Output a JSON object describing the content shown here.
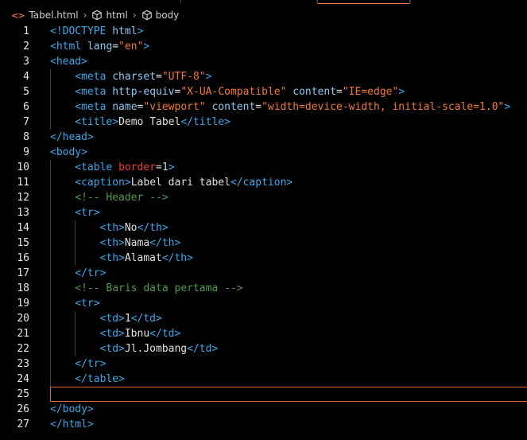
{
  "breadcrumb": {
    "file": "Tabel.html",
    "path": [
      "html",
      "body"
    ],
    "icons": [
      "code-brackets-icon",
      "cube-icon"
    ]
  },
  "editor": {
    "line_numbers": [
      "1",
      "2",
      "3",
      "4",
      "5",
      "6",
      "7",
      "8",
      "9",
      "10",
      "11",
      "12",
      "13",
      "14",
      "15",
      "16",
      "17",
      "18",
      "19",
      "20",
      "21",
      "22",
      "23",
      "24",
      "25",
      "26",
      "27"
    ],
    "current_line": "25",
    "lines": [
      [
        [
          "t",
          "<!DOCTYPE "
        ],
        [
          "a",
          "html"
        ],
        [
          "t",
          ">"
        ]
      ],
      [
        [
          "t",
          "<html "
        ],
        [
          "a",
          "lang"
        ],
        [
          "p",
          "="
        ],
        [
          "s",
          "\"en\""
        ],
        [
          "t",
          ">"
        ]
      ],
      [
        [
          "t",
          "<head>"
        ]
      ],
      [
        [
          "t",
          "<meta "
        ],
        [
          "a",
          "charset"
        ],
        [
          "p",
          "="
        ],
        [
          "s",
          "\"UTF-8\""
        ],
        [
          "t",
          ">"
        ]
      ],
      [
        [
          "t",
          "<meta "
        ],
        [
          "a",
          "http-equiv"
        ],
        [
          "p",
          "="
        ],
        [
          "s",
          "\"X-UA-Compatible\""
        ],
        [
          "p",
          " "
        ],
        [
          "a",
          "content"
        ],
        [
          "p",
          "="
        ],
        [
          "s",
          "\"IE=edge\""
        ],
        [
          "t",
          ">"
        ]
      ],
      [
        [
          "t",
          "<meta "
        ],
        [
          "a",
          "name"
        ],
        [
          "p",
          "="
        ],
        [
          "s",
          "\"viewport\""
        ],
        [
          "p",
          " "
        ],
        [
          "a",
          "content"
        ],
        [
          "p",
          "="
        ],
        [
          "s",
          "\"width=device-width, initial-scale=1.0\""
        ],
        [
          "t",
          ">"
        ]
      ],
      [
        [
          "t",
          "<title>"
        ],
        [
          "p",
          "Demo Tabel"
        ],
        [
          "t",
          "</title>"
        ]
      ],
      [
        [
          "t",
          "</head>"
        ]
      ],
      [
        [
          "t",
          "<body>"
        ]
      ],
      [
        [
          "t",
          "<table "
        ],
        [
          "r",
          "border"
        ],
        [
          "p",
          "="
        ],
        [
          "n",
          "1"
        ],
        [
          "t",
          ">"
        ]
      ],
      [
        [
          "t",
          "<caption>"
        ],
        [
          "p",
          "Label dari tabel"
        ],
        [
          "t",
          "</caption>"
        ]
      ],
      [
        [
          "c",
          "<!-- Header -->"
        ]
      ],
      [
        [
          "t",
          "<tr>"
        ]
      ],
      [
        [
          "t",
          "<th>"
        ],
        [
          "p",
          "No"
        ],
        [
          "t",
          "</th>"
        ]
      ],
      [
        [
          "t",
          "<th>"
        ],
        [
          "p",
          "Nama"
        ],
        [
          "t",
          "</th>"
        ]
      ],
      [
        [
          "t",
          "<th>"
        ],
        [
          "p",
          "Alamat"
        ],
        [
          "t",
          "</th>"
        ]
      ],
      [
        [
          "t",
          "</tr>"
        ]
      ],
      [
        [
          "c",
          "<!-- Baris data pertama -->"
        ]
      ],
      [
        [
          "t",
          "<tr>"
        ]
      ],
      [
        [
          "t",
          "<td>"
        ],
        [
          "p",
          "1"
        ],
        [
          "t",
          "</td>"
        ]
      ],
      [
        [
          "t",
          "<td>"
        ],
        [
          "p",
          "Ibnu"
        ],
        [
          "t",
          "</td>"
        ]
      ],
      [
        [
          "t",
          "<td>"
        ],
        [
          "p",
          "Jl.Jombang"
        ],
        [
          "t",
          "</td>"
        ]
      ],
      [
        [
          "t",
          "</tr>"
        ]
      ],
      [
        [
          "t",
          "</table>"
        ]
      ],
      [],
      [
        [
          "t",
          "</body>"
        ]
      ],
      [
        [
          "t",
          "</html>"
        ]
      ]
    ]
  }
}
